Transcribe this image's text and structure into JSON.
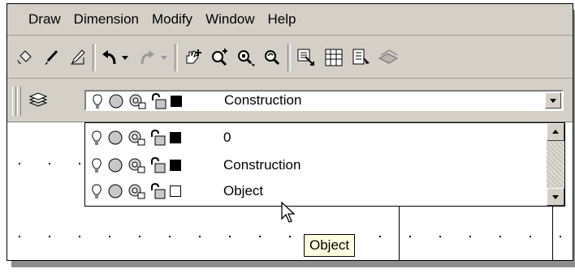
{
  "menu": {
    "items": [
      {
        "label": "Draw"
      },
      {
        "label": "Dimension"
      },
      {
        "label": "Modify"
      },
      {
        "label": "Window"
      },
      {
        "label": "Help"
      }
    ]
  },
  "toolbar": {
    "buttons": [
      "paint-bucket-icon",
      "brush-icon",
      "match-properties-icon",
      "undo-icon",
      "undo-dropdown-icon",
      "redo-icon",
      "redo-dropdown-icon",
      "pan-icon",
      "zoom-realtime-icon",
      "zoom-window-icon",
      "zoom-previous-icon",
      "properties-icon",
      "design-center-icon",
      "tool-palettes-icon",
      "sheet-set-icon"
    ]
  },
  "layer_control": {
    "current_layer": "Construction",
    "current_color": "#000000",
    "icons": [
      "layer-on-bulb-icon",
      "freeze-sun-icon",
      "freeze-viewport-icon",
      "lock-icon"
    ]
  },
  "layer_list": {
    "items": [
      {
        "name": "0",
        "color": "#000000",
        "selected": false
      },
      {
        "name": "Construction",
        "color": "#000000",
        "selected": false
      },
      {
        "name": "Object",
        "color": "#ffffff",
        "selected": true
      }
    ]
  },
  "tooltip": {
    "text": "Object"
  },
  "colors": {
    "chrome": "#d4d0c8",
    "selection": "#0a246a",
    "tooltip_bg": "#ffffe1"
  }
}
